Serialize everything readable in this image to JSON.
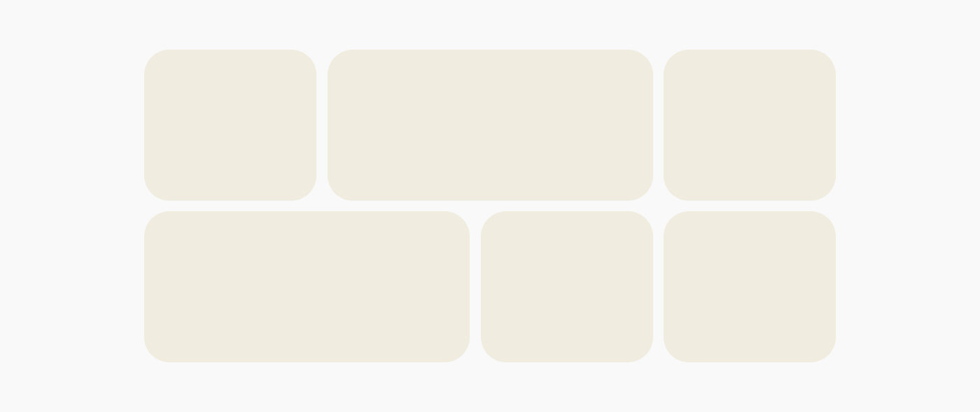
{
  "colors": {
    "background": "#f9f9f9",
    "tile_fill": "#f0ecdf"
  },
  "tiles": [
    {
      "id": "tile-1",
      "row": 1,
      "span": "small"
    },
    {
      "id": "tile-2",
      "row": 1,
      "span": "wide"
    },
    {
      "id": "tile-3",
      "row": 1,
      "span": "small"
    },
    {
      "id": "tile-4",
      "row": 2,
      "span": "wide"
    },
    {
      "id": "tile-5",
      "row": 2,
      "span": "small"
    },
    {
      "id": "tile-6",
      "row": 2,
      "span": "small"
    }
  ]
}
